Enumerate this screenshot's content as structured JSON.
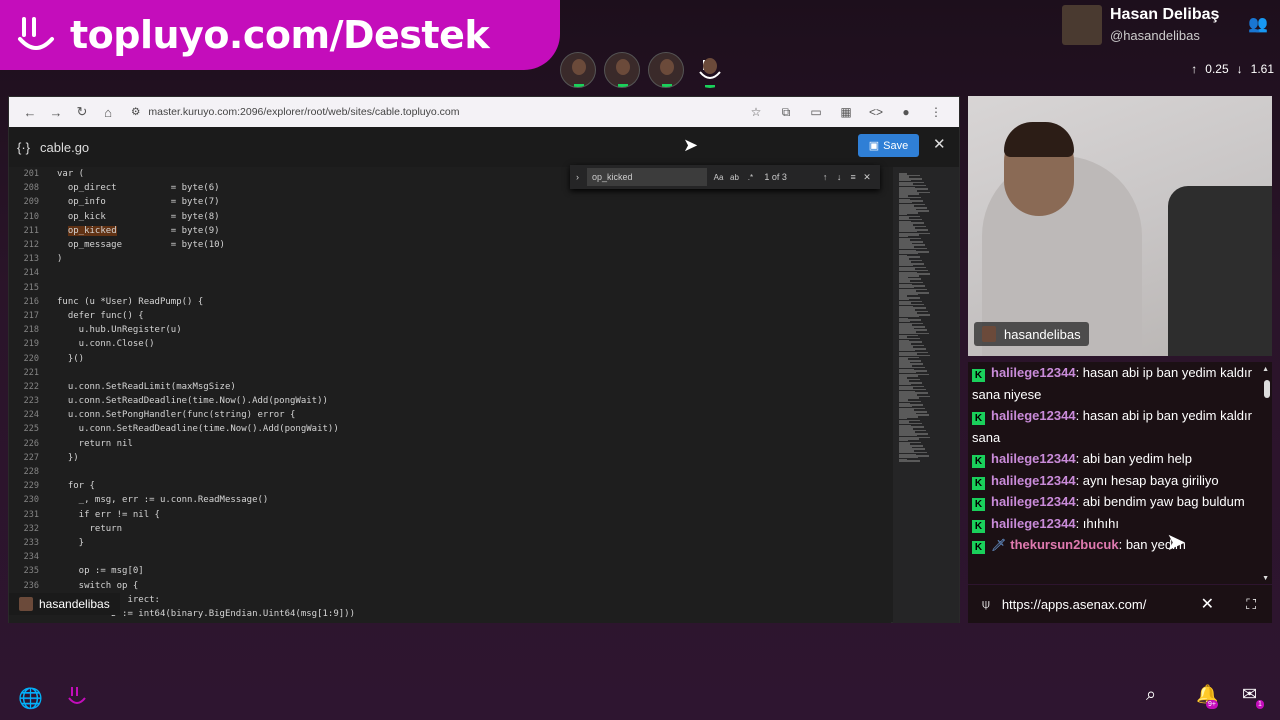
{
  "banner": {
    "text": "topluyo.com/Destek"
  },
  "profile": {
    "name": "Hasan Delibaş",
    "handle": "@hasandelibas",
    "upload": "0.25",
    "download": "1.61"
  },
  "browser": {
    "url": "master.kuruyo.com:2096/explorer/root/web/sites/cable.topluyo.com"
  },
  "editor": {
    "filename": "cable.go",
    "save_label": "Save",
    "user_chip": "hasandelibas"
  },
  "find": {
    "query": "op_kicked",
    "count": "1 of 3",
    "opt_case": "Aa",
    "opt_word": "ab",
    "opt_regex": ".*"
  },
  "code": [
    {
      "n": "201",
      "t": "var ("
    },
    {
      "n": "208",
      "t": "  op_direct          = byte(6)"
    },
    {
      "n": "209",
      "t": "  op_info            = byte(7)"
    },
    {
      "n": "210",
      "t": "  op_kick            = byte(8)"
    },
    {
      "n": "211",
      "t": "  op_kicked          = byte(9)"
    },
    {
      "n": "212",
      "t": "  op_message         = byte(10)"
    },
    {
      "n": "213",
      "t": ")"
    },
    {
      "n": "214",
      "t": ""
    },
    {
      "n": "215",
      "t": ""
    },
    {
      "n": "216",
      "t": "func (u *User) ReadPump() {"
    },
    {
      "n": "217",
      "t": "  defer func() {"
    },
    {
      "n": "218",
      "t": "    u.hub.UnRegister(u)"
    },
    {
      "n": "219",
      "t": "    u.conn.Close()"
    },
    {
      "n": "220",
      "t": "  }()"
    },
    {
      "n": "221",
      "t": ""
    },
    {
      "n": "222",
      "t": "  u.conn.SetReadLimit(maxMsgSize)"
    },
    {
      "n": "223",
      "t": "  u.conn.SetReadDeadline(time.Now().Add(pongWait))"
    },
    {
      "n": "224",
      "t": "  u.conn.SetPongHandler(func(string) error {"
    },
    {
      "n": "225",
      "t": "    u.conn.SetReadDeadline(time.Now().Add(pongWait))"
    },
    {
      "n": "226",
      "t": "    return nil"
    },
    {
      "n": "227",
      "t": "  })"
    },
    {
      "n": "228",
      "t": ""
    },
    {
      "n": "229",
      "t": "  for {"
    },
    {
      "n": "230",
      "t": "    _, msg, err := u.conn.ReadMessage()"
    },
    {
      "n": "231",
      "t": "    if err != nil {"
    },
    {
      "n": "232",
      "t": "      return"
    },
    {
      "n": "233",
      "t": "    }"
    },
    {
      "n": "234",
      "t": ""
    },
    {
      "n": "235",
      "t": "    op := msg[0]"
    },
    {
      "n": "236",
      "t": "    switch op {"
    },
    {
      "n": "",
      "t": "             irect:"
    },
    {
      "n": "",
      "t": "          D := int64(binary.BigEndian.Uint64(msg[1:9]))"
    }
  ],
  "camera": {
    "label": "hasandelibas"
  },
  "chat": [
    {
      "user": "halilege12344",
      "text": "hasan abi ip ban yedim kaldır sana niyese",
      "style": "user"
    },
    {
      "user": "halilege12344",
      "text": "hasan abi ip ban yedim kaldır sana",
      "style": "user"
    },
    {
      "user": "halilege12344",
      "text": "abi ban yedim help",
      "style": "user"
    },
    {
      "user": "halilege12344",
      "text": "aynı hesap baya giriliyo",
      "style": "user"
    },
    {
      "user": "halilege12344",
      "text": "abi bendim yaw bag buldum",
      "style": "user"
    },
    {
      "user": "halilege12344",
      "text": "ıhıhıhı",
      "style": "user"
    },
    {
      "user": "thekursun2bucuk",
      "text": "ban yedim",
      "style": "user2"
    }
  ],
  "chat_badge": "K",
  "urlbar": {
    "url": "https://apps.asenax.com/"
  },
  "notifications": {
    "bell": "9+",
    "mail": "1"
  }
}
